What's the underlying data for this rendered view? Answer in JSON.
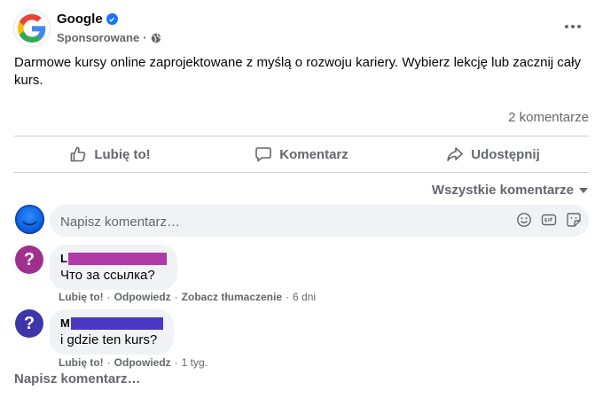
{
  "post": {
    "page_name": "Google",
    "sponsored_label": "Sponsorowane",
    "separator": "·",
    "text": "Darmowe kursy online zaprojektowane z myślą o rozwoju kariery. Wybierz lekcję lub zacznij cały kurs.",
    "comment_count": "2 komentarze"
  },
  "actions": {
    "like": "Lubię to!",
    "comment": "Komentarz",
    "share": "Udostępnij"
  },
  "comments_sort": "Wszystkie komentarze",
  "composer": {
    "placeholder": "Napisz komentarz…"
  },
  "comments": [
    {
      "author_initial": "L",
      "redaction_color": "#b03aa8",
      "avatar_color": "#a0308f",
      "avatar_glyph": "?",
      "text": "Что за ссылка?",
      "like": "Lubię to!",
      "reply": "Odpowiedz",
      "translate": "Zobacz tłumaczenie",
      "time": "6 dni"
    },
    {
      "author_initial": "M",
      "redaction_color": "#4a38c4",
      "avatar_color": "#3d36a8",
      "avatar_glyph": "?",
      "text": "i gdzie ten kurs?",
      "like": "Lubię to!",
      "reply": "Odpowiedz",
      "time": "1 tyg."
    }
  ],
  "write_comment_link": "Napisz komentarz…",
  "colors": {
    "accent": "#1877f2",
    "secondary_text": "#65676b",
    "bubble_bg": "#f0f2f5"
  }
}
